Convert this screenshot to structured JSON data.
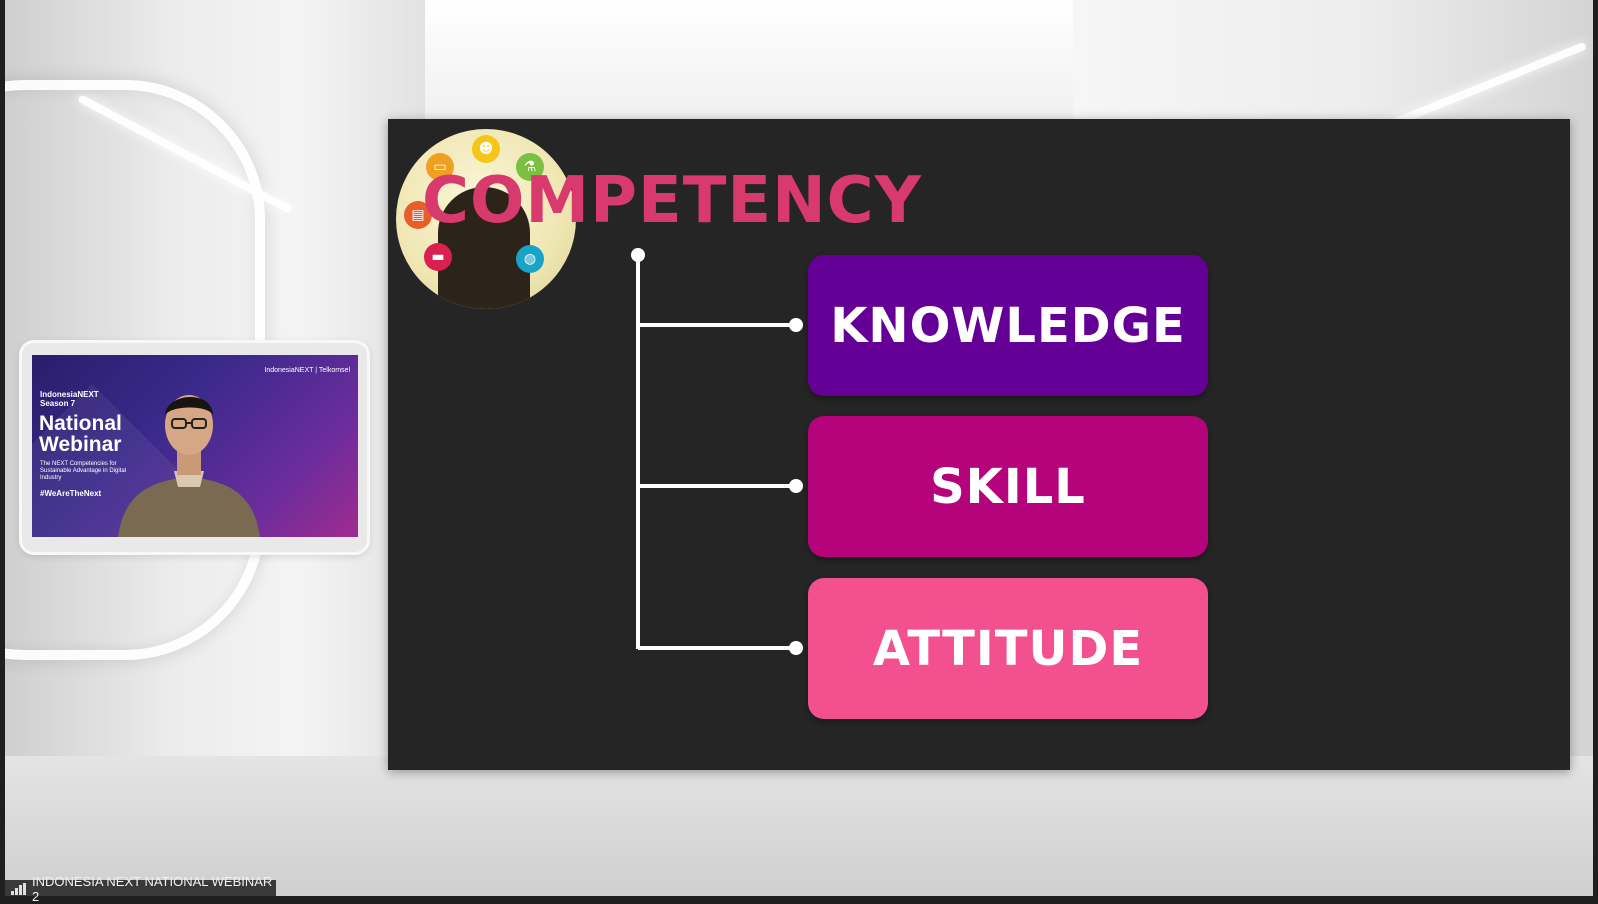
{
  "slide": {
    "title": "COMPETENCY",
    "items": [
      {
        "label": "KNOWLEDGE",
        "color": "#650097"
      },
      {
        "label": "SKILL",
        "color": "#b5037b"
      },
      {
        "label": "ATTITUDE",
        "color": "#f2508f"
      }
    ],
    "title_color": "#d93a6e",
    "background": "#262525"
  },
  "speaker_video": {
    "brand": "IndonesiaNEXT | Telkomsel",
    "event_line1": "IndonesiaNEXT",
    "event_line2": "Season 7",
    "heading_line1": "National",
    "heading_line2": "Webinar",
    "description": "The NEXT Competencies for Sustainable Advantage in Digital Industry",
    "hashtag": "#WeAreTheNext"
  },
  "participant_label": {
    "icon": "signal-icon",
    "name": "INDONESIA NEXT NATIONAL WEBINAR 2"
  }
}
